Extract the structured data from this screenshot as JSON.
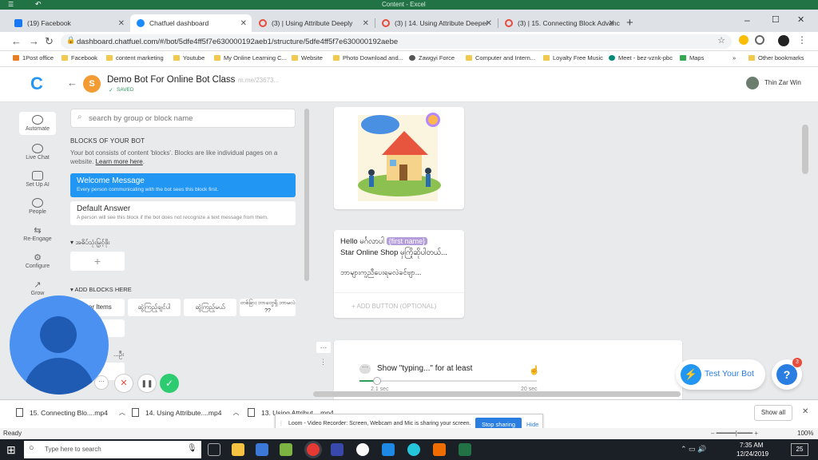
{
  "window_title": "Content - Excel",
  "browser": {
    "tabs": [
      {
        "label": "(19) Facebook",
        "color": "#1877f2"
      },
      {
        "label": "Chatfuel dashboard",
        "color": "#1a8cff"
      },
      {
        "label": "(3) | Using Attribute Deeply",
        "color": "#e74c3c"
      },
      {
        "label": "(3) | 14. Using Attribute Deeper",
        "color": "#e74c3c"
      },
      {
        "label": "(3) | 15. Connecting Block Advance",
        "color": "#e74c3c"
      }
    ],
    "url": "dashboard.chatfuel.com/#/bot/5dfe4ff5f7e630000192aeb1/structure/5dfe4ff5f7e630000192aebe",
    "bookmarks": [
      "1Post office",
      "Facebook",
      "content marketing",
      "Youtube",
      "My Online Learning C...",
      "Website",
      "Photo Download and...",
      "Zawgyi Force",
      "Computer and Intern...",
      "Loyalty Free Music",
      "Meet - bez-vznk-pbc",
      "Maps"
    ],
    "other_bookmarks": "Other bookmarks",
    "more": "»"
  },
  "app": {
    "logo": "C",
    "bot_avatar": "S",
    "bot_name": "Demo Bot For Online Bot Class",
    "saved": "SAVED",
    "bot_link": "m.me/23673...",
    "user_name": "Thin Zar Win",
    "nav": [
      "Automate",
      "Live Chat",
      "Set Up AI",
      "People",
      "Re-Engage",
      "Configure",
      "Grow"
    ],
    "search_placeholder": "search by group or block name",
    "blocks_heading": "BLOCKS OF YOUR BOT",
    "blocks_desc": "Your bot consists of content 'blocks'. Blocks are like individual pages on a website.",
    "learn_more": "Learn more here",
    "welcome_title": "Welcome Message",
    "welcome_sub": "Every person communicating with the bot sees this block first.",
    "default_title": "Default Answer",
    "default_sub": "A person will see this block if the bot does not recognize a text message from them.",
    "group1": "အဓိပ်သုံးမြှင့်ဖိုး",
    "plus": "+",
    "add_blocks": "ADD BLOCKS HERE",
    "block_items": [
      "...er Items",
      "ဆွဲကြည့်ချင်ပါ",
      "ဆွဲကြည့်မယ်",
      "တစ်ခြား ဘာတွေရှိ ဘာမလဲ ??"
    ],
    "group2": "...ဦး",
    "msg_line1": "Hello မင်္ဂလာပါ",
    "msg_attr": "{first name}",
    "msg_line2": "Star Online Shop မှကြိုဆိုပါတယ်...",
    "msg_line3": "ဘာများကူညီပေးရမလဲခင်ဗျာ...",
    "add_button": "ADD BUTTON (OPTIONAL)",
    "typing_label": "Show \"typing...\" for at least",
    "typing_min": "2.1 sec",
    "typing_max": "20 sec",
    "typing_value": 0.1,
    "test_bot": "Test Your Bot",
    "help_badge": "3"
  },
  "downloads": {
    "items": [
      "15. Connecting Blo....mp4",
      "14. Using Attribute....mp4",
      "13. Using Attribut....mp4"
    ],
    "show_all": "Show all"
  },
  "loom": {
    "text": "Loom - Video Recorder: Screen, Webcam and Mic is sharing your screen.",
    "stop": "Stop sharing",
    "hide": "Hide"
  },
  "excel": {
    "status": "Ready",
    "zoom": "100%"
  },
  "taskbar": {
    "search": "Type here to search",
    "time": "7:35 AM",
    "date": "12/24/2019",
    "notif": "25"
  }
}
